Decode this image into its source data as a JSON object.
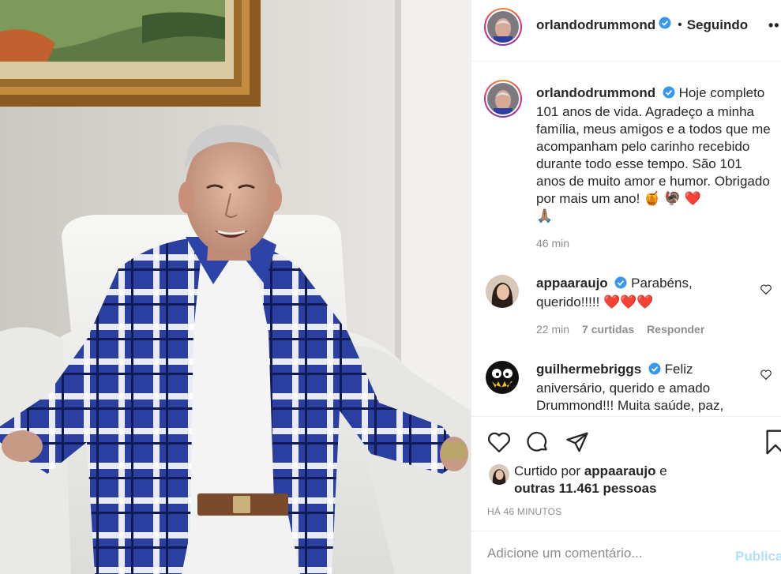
{
  "post": {
    "author": "orlandodrummond",
    "follow_status": "Seguindo",
    "more_label": "••",
    "caption": "Hoje completo 101 anos de vida. Agradeço a minha família, meus amigos e a todos que me acompanham pelo carinho recebido durante todo esse tempo. São 101 anos de muito amor e humor. Obrigado por mais um ano! 🍯 🦃 ❤️",
    "caption_emoji_end": "🙏🏽",
    "caption_age": "46 min",
    "verified_icon": "verified-badge-icon"
  },
  "comments": [
    {
      "username": "appaaraujo",
      "verified": true,
      "text": "Parabéns, querido!!!!! ❤️❤️❤️",
      "age": "22 min",
      "likes": "7 curtidas",
      "reply": "Responder"
    },
    {
      "username": "guilhermebriggs",
      "verified": true,
      "text": "Feliz aniversário, querido e amado Drummond!!! Muita saúde, paz,"
    }
  ],
  "actions": {
    "liked_by_prefix": "Curtido por",
    "liked_by_user": "appaaraujo",
    "liked_by_and": "e",
    "liked_by_others": "outras 11.461 pessoas",
    "timestamp": "HÁ 46 MINUTOS"
  },
  "add_comment": {
    "placeholder": "Adicione um comentário...",
    "post_label": "Publicar"
  },
  "colors": {
    "verified": "#3897f0",
    "post_button": "#b2dffc",
    "muted": "#8e8e8e",
    "heart": "#e0245e"
  }
}
